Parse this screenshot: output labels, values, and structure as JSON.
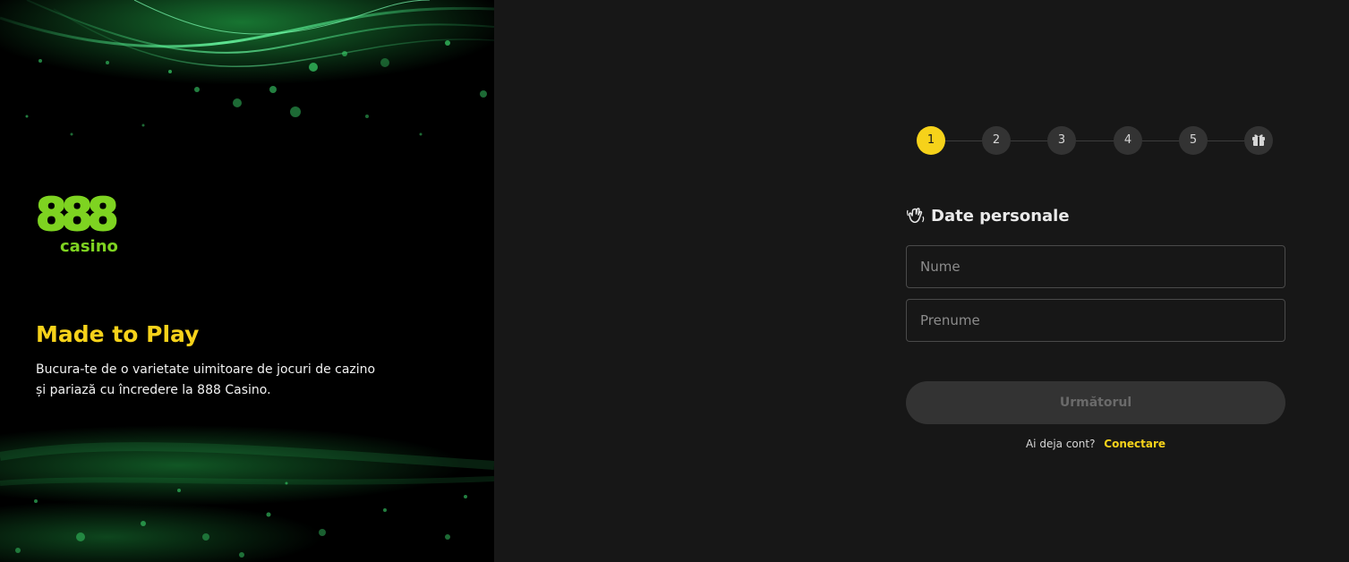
{
  "brand": {
    "logo_number": "888",
    "logo_word": "casino",
    "logo_color": "#7ed321",
    "accent_color": "#f6d21a"
  },
  "promo": {
    "title": "Made to Play",
    "text_line1": "Bucura-te de o varietate uimitoare de jocuri de cazino",
    "text_line2": "și pariază cu încredere la 888 Casino."
  },
  "stepper": {
    "current_step": 1,
    "steps": [
      "1",
      "2",
      "3",
      "4",
      "5"
    ],
    "final_step_icon": "gift-icon"
  },
  "form": {
    "section_icon": "waving-hand-icon",
    "section_title": "Date personale",
    "first_name_placeholder": "Nume",
    "last_name_placeholder": "Prenume",
    "next_label": "Următorul",
    "have_account_text": "Ai deja cont?",
    "login_link": "Conectare"
  }
}
